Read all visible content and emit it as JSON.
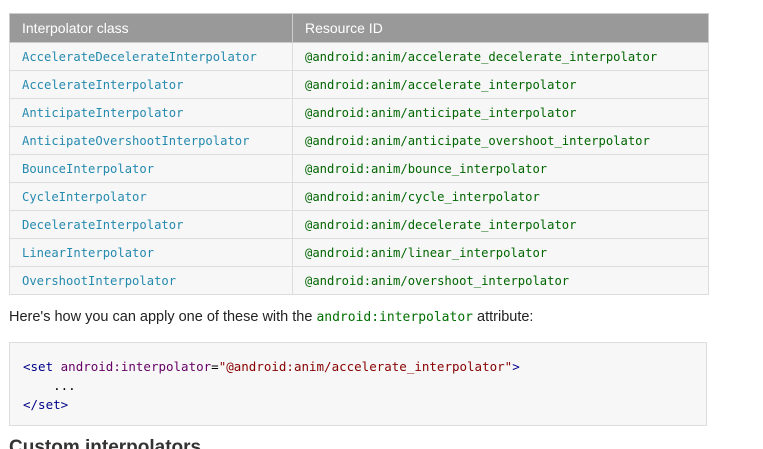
{
  "table": {
    "headers": [
      "Interpolator class",
      "Resource ID"
    ],
    "rows": [
      {
        "cls": "AccelerateDecelerateInterpolator",
        "res": "@android:anim/accelerate_decelerate_interpolator"
      },
      {
        "cls": "AccelerateInterpolator",
        "res": "@android:anim/accelerate_interpolator"
      },
      {
        "cls": "AnticipateInterpolator",
        "res": "@android:anim/anticipate_interpolator"
      },
      {
        "cls": "AnticipateOvershootInterpolator",
        "res": "@android:anim/anticipate_overshoot_interpolator"
      },
      {
        "cls": "BounceInterpolator",
        "res": "@android:anim/bounce_interpolator"
      },
      {
        "cls": "CycleInterpolator",
        "res": "@android:anim/cycle_interpolator"
      },
      {
        "cls": "DecelerateInterpolator",
        "res": "@android:anim/decelerate_interpolator"
      },
      {
        "cls": "LinearInterpolator",
        "res": "@android:anim/linear_interpolator"
      },
      {
        "cls": "OvershootInterpolator",
        "res": "@android:anim/overshoot_interpolator"
      }
    ]
  },
  "paragraph": {
    "before": "Here's how you can apply one of these with the ",
    "code": "android:interpolator",
    "after": " attribute:"
  },
  "code_example": {
    "line1_open": "<set",
    "line1_attr": "android:interpolator",
    "line1_eq": "=",
    "line1_value": "\"@android:anim/accelerate_interpolator\"",
    "line1_close": ">",
    "line2": "    ...",
    "line3": "</set>"
  },
  "next_heading": "Custom interpolators",
  "colors": {
    "header_bg": "#999999",
    "class_link": "#258aaf",
    "resource_id": "#006600"
  }
}
